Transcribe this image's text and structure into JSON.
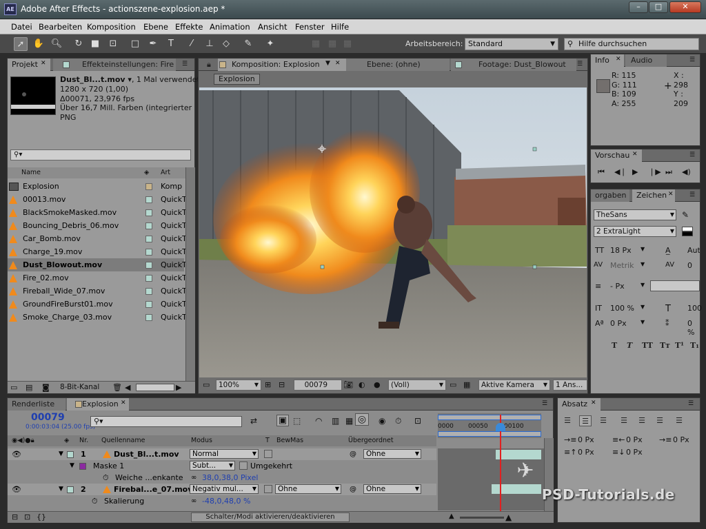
{
  "app": {
    "icon_text": "AE",
    "title": "Adobe After Effects - actionszene-explosion.aep *",
    "window_controls": {
      "minimize": "–",
      "maximize": "□",
      "close": "✕"
    }
  },
  "menu": [
    "Datei",
    "Bearbeiten",
    "Komposition",
    "Ebene",
    "Effekte",
    "Animation",
    "Ansicht",
    "Fenster",
    "Hilfe"
  ],
  "toolbar": {
    "workspace_label": "Arbeitsbereich:",
    "workspace_value": "Standard",
    "search_placeholder": "Hilfe durchsuchen"
  },
  "project_panel": {
    "tab_project": "Projekt",
    "tab_effects": "Effekteinstellungen: Fire",
    "selected_name": "Dust_Bl...t.mov ▾",
    "selected_usage": ", 1 Mal verwendet",
    "info_lines": [
      "1280 x 720 (1,00)",
      "Δ00071, 23,976 fps",
      "Über 16,7 Mill. Farben (integrierter ...",
      "PNG"
    ],
    "search_value": "",
    "col_name": "Name",
    "col_type": "Art",
    "items": [
      {
        "name": "Explosion",
        "type": "Komp",
        "icon": "composition",
        "swatch": "#c9b48a",
        "selected": false,
        "bold": false
      },
      {
        "name": "00013.mov",
        "type": "QuickT",
        "icon": "footage",
        "swatch": "#b4d8cf",
        "selected": false,
        "bold": false
      },
      {
        "name": "BlackSmokeMasked.mov",
        "type": "QuickT",
        "icon": "footage",
        "swatch": "#b4d8cf",
        "selected": false,
        "bold": false
      },
      {
        "name": "Bouncing_Debris_06.mov",
        "type": "QuickT",
        "icon": "footage",
        "swatch": "#b4d8cf",
        "selected": false,
        "bold": false
      },
      {
        "name": "Car_Bomb.mov",
        "type": "QuickT",
        "icon": "footage",
        "swatch": "#b4d8cf",
        "selected": false,
        "bold": false
      },
      {
        "name": "Charge_19.mov",
        "type": "QuickT",
        "icon": "footage",
        "swatch": "#b4d8cf",
        "selected": false,
        "bold": false
      },
      {
        "name": "Dust_Blowout.mov",
        "type": "QuickT",
        "icon": "footage",
        "swatch": "#b4d8cf",
        "selected": true,
        "bold": true
      },
      {
        "name": "Fire_02.mov",
        "type": "QuickT",
        "icon": "footage",
        "swatch": "#b4d8cf",
        "selected": false,
        "bold": false
      },
      {
        "name": "Fireball_Wide_07.mov",
        "type": "QuickT",
        "icon": "footage",
        "swatch": "#b4d8cf",
        "selected": false,
        "bold": false
      },
      {
        "name": "GroundFireBurst01.mov",
        "type": "QuickT",
        "icon": "footage",
        "swatch": "#b4d8cf",
        "selected": false,
        "bold": false
      },
      {
        "name": "Smoke_Charge_03.mov",
        "type": "QuickT",
        "icon": "footage",
        "swatch": "#b4d8cf",
        "selected": false,
        "bold": false
      }
    ],
    "bit_depth": "8-Bit-Kanal"
  },
  "comp_panel": {
    "tab_comp": "Komposition: Explosion",
    "tab_layer": "Ebene: (ohne)",
    "tab_footage": "Footage: Dust_Blowout",
    "breadcrumb": "Explosion",
    "zoom": "100%",
    "timecode": "00079",
    "resolution": "(Voll)",
    "camera": "Aktive Kamera",
    "views": "1 Ans..."
  },
  "info_panel": {
    "tab_info": "Info",
    "tab_audio": "Audio",
    "r": "R:  115",
    "g": "G:  111",
    "b": "B:  109",
    "a": "A:  255",
    "x": "X : 298",
    "y": "Y : 209",
    "swatch_color": "#736f6d"
  },
  "preview_panel": {
    "tab": "Vorschau"
  },
  "character_panel": {
    "tab_left": "orgaben",
    "tab_right": "Zeichen",
    "font": "TheSans",
    "style": "2 ExtraLight",
    "size": "18 Px",
    "leading": "Auto",
    "kerning": "Metrik",
    "tracking": "0",
    "stroke": "- Px",
    "vscale": "100 %",
    "hscale": "100",
    "baseline": "0 Px",
    "tsume": "0 %",
    "style_buttons": [
      "T",
      "T",
      "TT",
      "Tт",
      "T¹",
      "T₁"
    ]
  },
  "timeline": {
    "tab_render": "Renderliste",
    "tab_comp": "Explosion",
    "timecode": "00079",
    "timecode_sub": "0:00:03:04 (25.00 fps)",
    "col_nr": "Nr.",
    "col_source": "Quellenname",
    "col_mode": "Modus",
    "col_t": "T",
    "col_trkmat": "BewMas",
    "col_parent": "Übergeordnet",
    "ruler": [
      "0000",
      "00050",
      "00100"
    ],
    "rows": [
      {
        "kind": "layer",
        "nr": "1",
        "name": "Dust_Bl...t.mov",
        "mode": "Normal",
        "trkmat": "",
        "parent": "Ohne"
      },
      {
        "kind": "mask",
        "name": "Maske 1",
        "mode": "Subt...",
        "inverted": "Umgekehrt"
      },
      {
        "kind": "prop",
        "name": "Weiche ...enkante",
        "value": "38,0,38,0 Pixel"
      },
      {
        "kind": "layer",
        "nr": "2",
        "name": "Firebal...e_07.mov",
        "mode": "Negativ mul...",
        "trkmat": "Ohne",
        "parent": "Ohne"
      },
      {
        "kind": "prop",
        "name": "Skalierung",
        "value": "-48,0,48,0 %"
      }
    ],
    "footer_toggle": "Schalter/Modi aktivieren/deaktivieren"
  },
  "paragraph_panel": {
    "tab": "Absatz",
    "indent_left": "0 Px",
    "indent_right": "0 Px",
    "indent_first": "0 Px",
    "space_before": "0 Px",
    "space_after": "0 Px"
  },
  "watermark": "PSD-Tutorials.de"
}
